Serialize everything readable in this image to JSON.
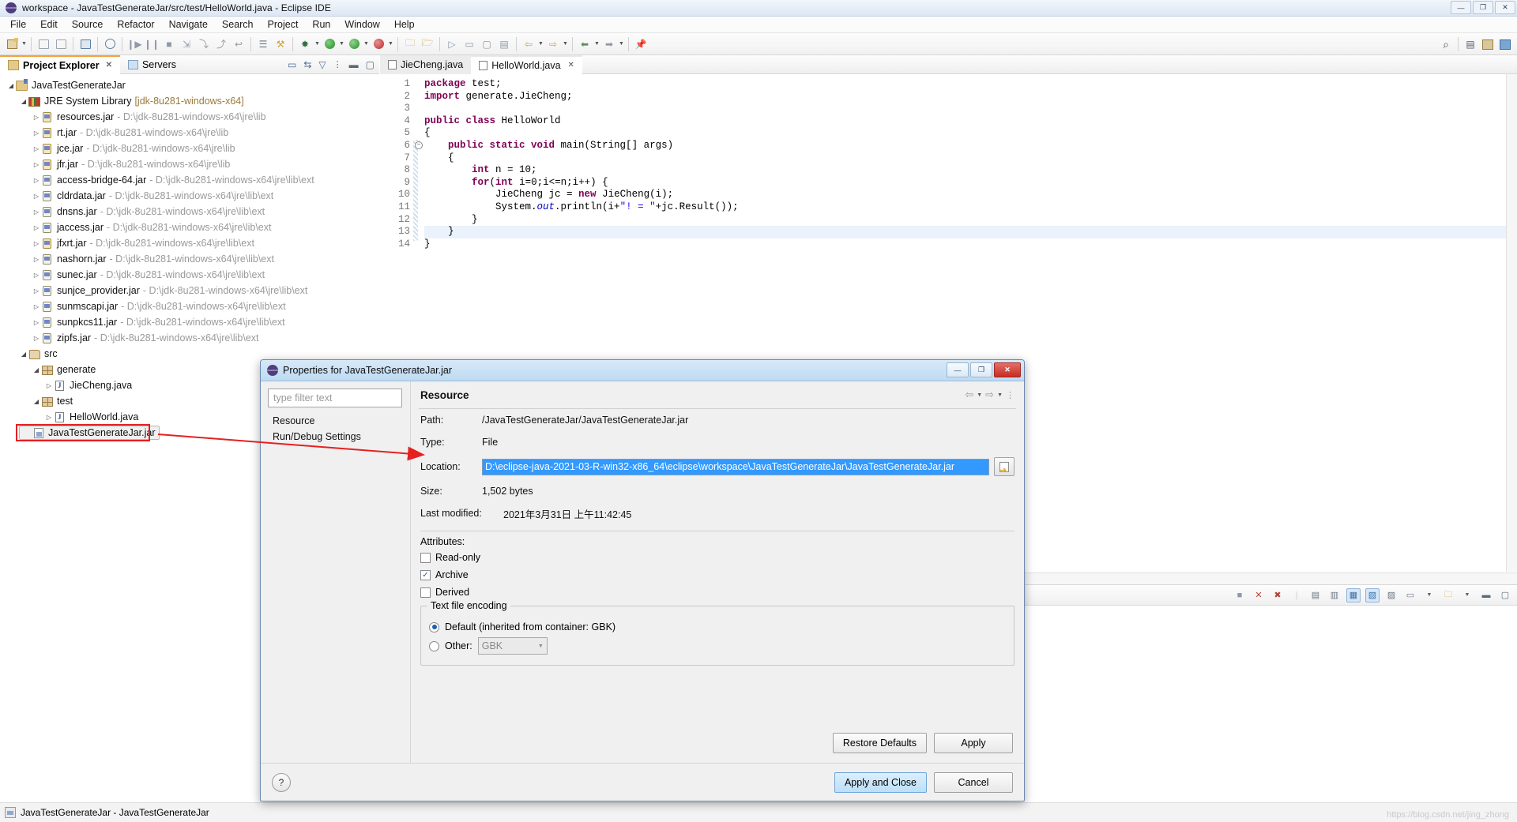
{
  "window": {
    "title": "workspace - JavaTestGenerateJar/src/test/HelloWorld.java - Eclipse IDE",
    "min": "—",
    "max": "❐",
    "close": "✕"
  },
  "menu": [
    "File",
    "Edit",
    "Source",
    "Refactor",
    "Navigate",
    "Search",
    "Project",
    "Run",
    "Window",
    "Help"
  ],
  "explorer": {
    "tabs": [
      {
        "label": "Project Explorer",
        "icon": "project-explorer-icon",
        "closable": true,
        "active": true
      },
      {
        "label": "Servers",
        "icon": "servers-icon",
        "closable": false,
        "active": false
      }
    ],
    "view_actions": [
      "collapse-all-icon",
      "link-with-editor-icon",
      "view-menu-filter-icon",
      "view-menu-icon"
    ],
    "tree": [
      {
        "indent": 0,
        "arrow": "open",
        "icon": "project-icon",
        "label": "JavaTestGenerateJar",
        "path": "",
        "bracket": ""
      },
      {
        "indent": 1,
        "arrow": "open",
        "icon": "library-icon",
        "label": "JRE System Library",
        "path": "",
        "bracket": "[jdk-8u281-windows-x64]"
      },
      {
        "indent": 2,
        "arrow": "closed",
        "icon": "jar-gold-icon",
        "label": "resources.jar",
        "path": "- D:\\jdk-8u281-windows-x64\\jre\\lib"
      },
      {
        "indent": 2,
        "arrow": "closed",
        "icon": "jar-gold-icon",
        "label": "rt.jar",
        "path": "- D:\\jdk-8u281-windows-x64\\jre\\lib"
      },
      {
        "indent": 2,
        "arrow": "closed",
        "icon": "jar-gold-icon",
        "label": "jce.jar",
        "path": "- D:\\jdk-8u281-windows-x64\\jre\\lib"
      },
      {
        "indent": 2,
        "arrow": "closed",
        "icon": "jar-gold-icon",
        "label": "jfr.jar",
        "path": "- D:\\jdk-8u281-windows-x64\\jre\\lib"
      },
      {
        "indent": 2,
        "arrow": "closed",
        "icon": "jar-icon",
        "label": "access-bridge-64.jar",
        "path": "- D:\\jdk-8u281-windows-x64\\jre\\lib\\ext"
      },
      {
        "indent": 2,
        "arrow": "closed",
        "icon": "jar-icon",
        "label": "cldrdata.jar",
        "path": "- D:\\jdk-8u281-windows-x64\\jre\\lib\\ext"
      },
      {
        "indent": 2,
        "arrow": "closed",
        "icon": "jar-icon",
        "label": "dnsns.jar",
        "path": "- D:\\jdk-8u281-windows-x64\\jre\\lib\\ext"
      },
      {
        "indent": 2,
        "arrow": "closed",
        "icon": "jar-icon",
        "label": "jaccess.jar",
        "path": "- D:\\jdk-8u281-windows-x64\\jre\\lib\\ext"
      },
      {
        "indent": 2,
        "arrow": "closed",
        "icon": "jar-gold-icon",
        "label": "jfxrt.jar",
        "path": "- D:\\jdk-8u281-windows-x64\\jre\\lib\\ext"
      },
      {
        "indent": 2,
        "arrow": "closed",
        "icon": "jar-icon",
        "label": "nashorn.jar",
        "path": "- D:\\jdk-8u281-windows-x64\\jre\\lib\\ext"
      },
      {
        "indent": 2,
        "arrow": "closed",
        "icon": "jar-icon",
        "label": "sunec.jar",
        "path": "- D:\\jdk-8u281-windows-x64\\jre\\lib\\ext"
      },
      {
        "indent": 2,
        "arrow": "closed",
        "icon": "jar-icon",
        "label": "sunjce_provider.jar",
        "path": "- D:\\jdk-8u281-windows-x64\\jre\\lib\\ext"
      },
      {
        "indent": 2,
        "arrow": "closed",
        "icon": "jar-icon",
        "label": "sunmscapi.jar",
        "path": "- D:\\jdk-8u281-windows-x64\\jre\\lib\\ext"
      },
      {
        "indent": 2,
        "arrow": "closed",
        "icon": "jar-icon",
        "label": "sunpkcs11.jar",
        "path": "- D:\\jdk-8u281-windows-x64\\jre\\lib\\ext"
      },
      {
        "indent": 2,
        "arrow": "closed",
        "icon": "jar-icon",
        "label": "zipfs.jar",
        "path": "- D:\\jdk-8u281-windows-x64\\jre\\lib\\ext"
      },
      {
        "indent": 1,
        "arrow": "open",
        "icon": "source-folder-icon",
        "label": "src",
        "path": ""
      },
      {
        "indent": 2,
        "arrow": "open",
        "icon": "package-icon",
        "label": "generate",
        "path": ""
      },
      {
        "indent": 3,
        "arrow": "closed",
        "icon": "java-file-icon",
        "label": "JieCheng.java",
        "path": ""
      },
      {
        "indent": 2,
        "arrow": "open",
        "icon": "package-icon",
        "label": "test",
        "path": ""
      },
      {
        "indent": 3,
        "arrow": "closed",
        "icon": "java-file-icon",
        "label": "HelloWorld.java",
        "path": ""
      },
      {
        "indent": 1,
        "arrow": "none",
        "icon": "jar-file-icon",
        "label": "JavaTestGenerateJar.jar",
        "path": "",
        "selected": true,
        "annotated": true
      }
    ]
  },
  "editor": {
    "tabs": [
      {
        "label": "JieCheng.java",
        "active": false,
        "closable": false
      },
      {
        "label": "HelloWorld.java",
        "active": true,
        "closable": true
      }
    ],
    "lines": [
      {
        "n": 1,
        "html": "<span class=\"kw\">package</span> test;"
      },
      {
        "n": 2,
        "html": "<span class=\"kw\">import</span> generate.JieCheng;"
      },
      {
        "n": 3,
        "html": ""
      },
      {
        "n": 4,
        "html": "<span class=\"kw\">public class</span> HelloWorld"
      },
      {
        "n": 5,
        "html": "{"
      },
      {
        "n": 6,
        "html": "    <span class=\"kw\">public static void</span> main(String[] args)",
        "fold": true
      },
      {
        "n": 7,
        "html": "    {"
      },
      {
        "n": 8,
        "html": "        <span class=\"kw\">int</span> n = 10;"
      },
      {
        "n": 9,
        "html": "        <span class=\"kw\">for</span>(<span class=\"kw\">int</span> i=0;i&lt;=n;i++) {"
      },
      {
        "n": 10,
        "html": "            JieCheng jc = <span class=\"kw\">new</span> JieCheng(i);"
      },
      {
        "n": 11,
        "html": "            System.<span class=\"fld\">out</span>.println(i+<span class=\"str\">\"! = \"</span>+jc.Result());"
      },
      {
        "n": 12,
        "html": "        }"
      },
      {
        "n": 13,
        "html": "    }",
        "current": true
      },
      {
        "n": 14,
        "html": "}"
      }
    ]
  },
  "dialog": {
    "title": "Properties for JavaTestGenerateJar.jar",
    "filter_placeholder": "type filter text",
    "nav": [
      {
        "label": "Resource",
        "selected": true
      },
      {
        "label": "Run/Debug Settings",
        "selected": false
      }
    ],
    "page_title": "Resource",
    "fields": [
      {
        "label": "Path:",
        "value": "/JavaTestGenerateJar/JavaTestGenerateJar.jar"
      },
      {
        "label": "Type:",
        "value": "File"
      }
    ],
    "location": {
      "label": "Location:",
      "value": "D:\\eclipse-java-2021-03-R-win32-x86_64\\eclipse\\workspace\\JavaTestGenerateJar\\JavaTestGenerateJar.jar",
      "browse_icon": "resolve-path-icon"
    },
    "size": {
      "label": "Size:",
      "value": "1,502  bytes"
    },
    "last_modified": {
      "label": "Last modified:",
      "value": "2021年3月31日 上午11:42:45"
    },
    "attributes_label": "Attributes:",
    "checkboxes": [
      {
        "label": "Read-only",
        "checked": false
      },
      {
        "label": "Archive",
        "checked": true
      },
      {
        "label": "Derived",
        "checked": false
      }
    ],
    "encoding": {
      "group_label": "Text file encoding",
      "default_label": "Default (inherited from container: GBK)",
      "default_selected": true,
      "other_label": "Other:",
      "other_selected": false,
      "other_value": "GBK"
    },
    "buttons": {
      "restore_defaults": "Restore Defaults",
      "apply": "Apply",
      "apply_and_close": "Apply and Close",
      "cancel": "Cancel",
      "help": "?"
    },
    "window_buttons": {
      "min": "—",
      "max": "❐",
      "close": "✕"
    }
  },
  "statusbar": {
    "text": "JavaTestGenerateJar - JavaTestGenerateJar"
  },
  "watermark": "https://blog.csdn.net/jing_zhong",
  "colors": {
    "selection_blue": "#3399ff",
    "annotation_red": "#e62020",
    "keyword_purple": "#7f0055",
    "string_blue": "#2a00ff"
  }
}
